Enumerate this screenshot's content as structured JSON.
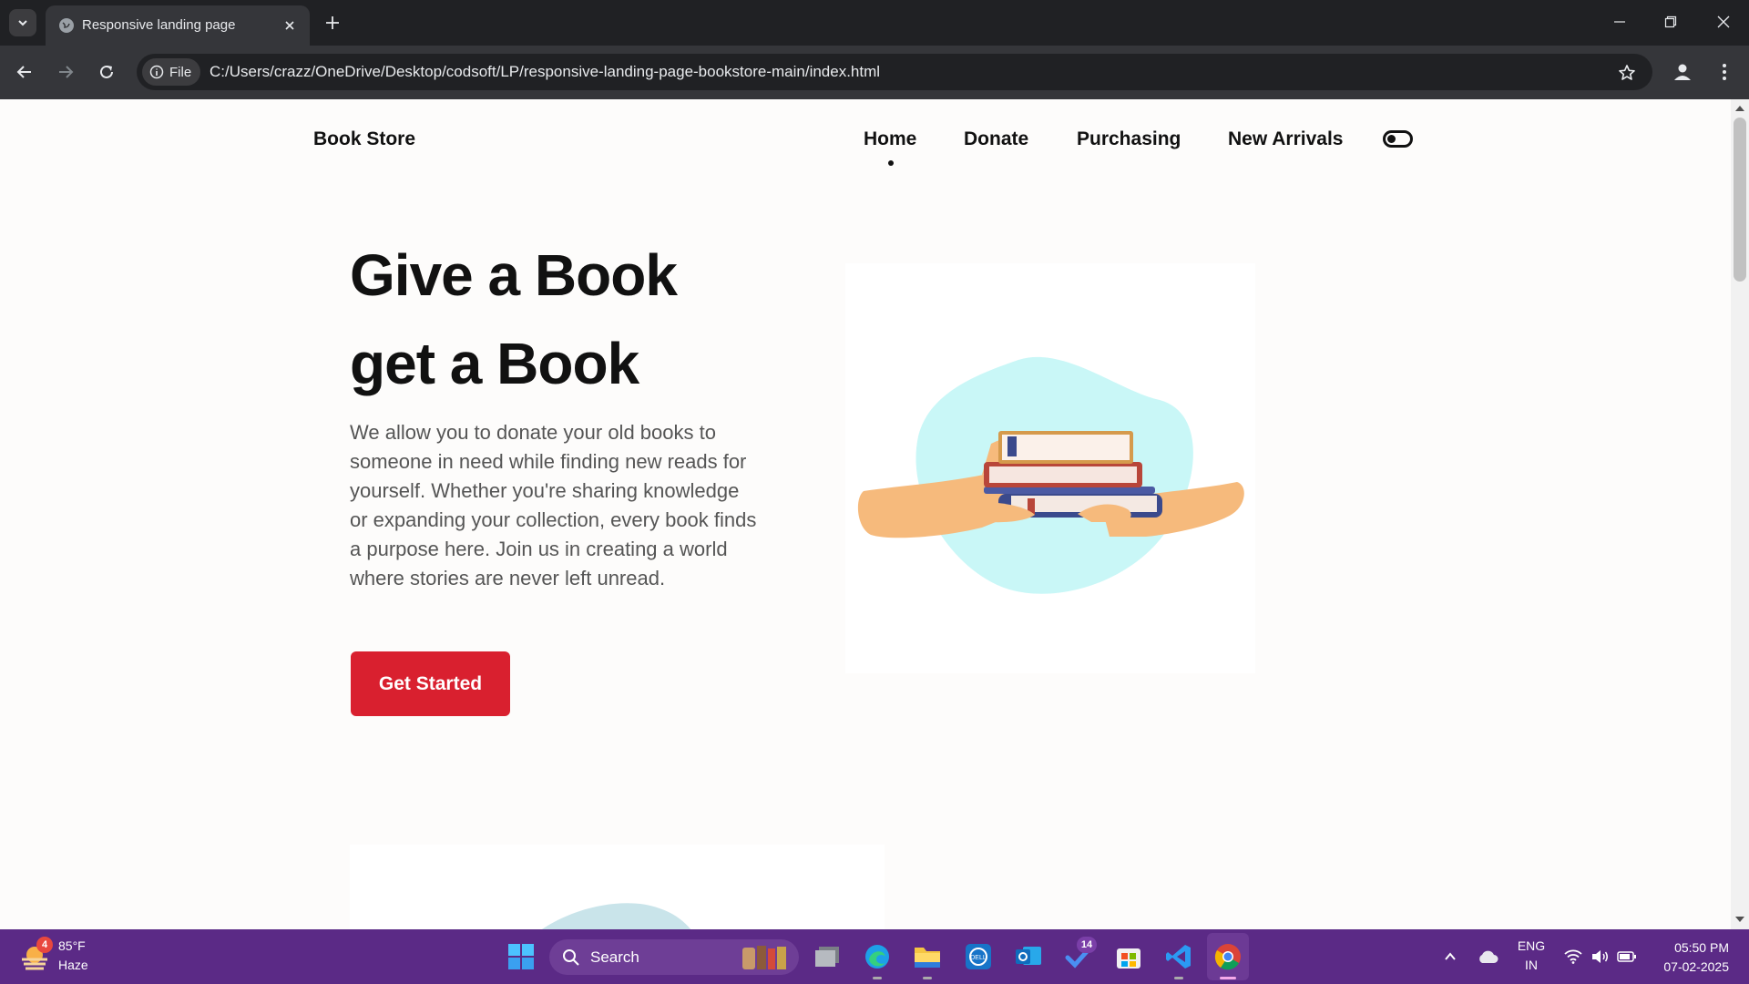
{
  "browser": {
    "tab_title": "Responsive landing page",
    "site_info_label": "File",
    "url": "C:/Users/crazz/OneDrive/Desktop/codsoft/LP/responsive-landing-page-bookstore-main/index.html"
  },
  "page": {
    "brand": "Book Store",
    "nav": [
      "Home",
      "Donate",
      "Purchasing",
      "New Arrivals"
    ],
    "active_nav": "Home",
    "hero_title_line1": "Give a Book",
    "hero_title_line2": "get a Book",
    "hero_text": "We allow you to donate your old books to someone in need while finding new reads for yourself. Whether you're sharing knowledge or expanding your collection, every book finds a purpose here. Join us in creating a world where stories are never left unread.",
    "cta_label": "Get Started",
    "accent_color": "#d9202f",
    "illustration_blob_color": "#c9f7f7"
  },
  "taskbar": {
    "weather_temp": "85°F",
    "weather_condition": "Haze",
    "weather_badge": "4",
    "search_label": "Search",
    "badge_count": "14",
    "lang_line1": "ENG",
    "lang_line2": "IN",
    "time": "05:50 PM",
    "date": "07-02-2025",
    "taskbar_color": "#5b2a86"
  }
}
